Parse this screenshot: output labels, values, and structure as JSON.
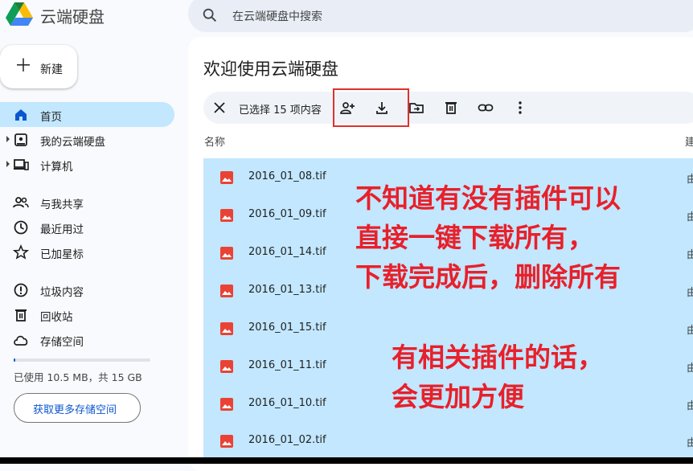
{
  "header": {
    "app_title": "云端硬盘",
    "search_placeholder": "在云端硬盘中搜索"
  },
  "new_button": {
    "label": "新建"
  },
  "sidebar": {
    "items": [
      {
        "label": "首页",
        "icon": "home-icon",
        "active": true
      },
      {
        "label": "我的云端硬盘",
        "icon": "my-drive-icon",
        "expandable": true
      },
      {
        "label": "计算机",
        "icon": "computer-icon",
        "expandable": true
      },
      {
        "label": "与我共享",
        "icon": "shared-icon"
      },
      {
        "label": "最近用过",
        "icon": "clock-icon"
      },
      {
        "label": "已加星标",
        "icon": "star-icon"
      },
      {
        "label": "垃圾内容",
        "icon": "spam-icon"
      },
      {
        "label": "回收站",
        "icon": "trash-icon"
      },
      {
        "label": "存储空间",
        "icon": "cloud-icon"
      }
    ],
    "storage": {
      "text": "已使用 10.5 MB，共 15 GB",
      "used_fraction": 0.0007,
      "button_label": "获取更多存储空间"
    }
  },
  "main": {
    "title": "欢迎使用云端硬盘",
    "selection": {
      "count_text": "已选择 15 项内容",
      "actions": [
        "share-icon",
        "download-icon",
        "move-icon",
        "delete-icon",
        "link-icon",
        "more-icon"
      ]
    },
    "columns": {
      "name": "名称",
      "owner": "建"
    },
    "files": [
      {
        "name": "2016_01_08.tif",
        "owner": "由"
      },
      {
        "name": "2016_01_09.tif",
        "owner": "由"
      },
      {
        "name": "2016_01_14.tif",
        "owner": "由"
      },
      {
        "name": "2016_01_13.tif",
        "owner": "由"
      },
      {
        "name": "2016_01_15.tif",
        "owner": "由"
      },
      {
        "name": "2016_01_11.tif",
        "owner": "由"
      },
      {
        "name": "2016_01_10.tif",
        "owner": "由"
      },
      {
        "name": "2016_01_02.tif",
        "owner": "由"
      }
    ]
  },
  "annotation": {
    "line1": "不知道有没有插件可以",
    "line2": "直接一键下载所有，",
    "line3": "下载完成后，删除所有",
    "line4": "有相关插件的话，",
    "line5": "会更加方便",
    "color": "#e8202a"
  },
  "colors": {
    "selected_row": "#c2e7ff",
    "accent": "#0b57d0",
    "file_icon": "#ea4335"
  }
}
